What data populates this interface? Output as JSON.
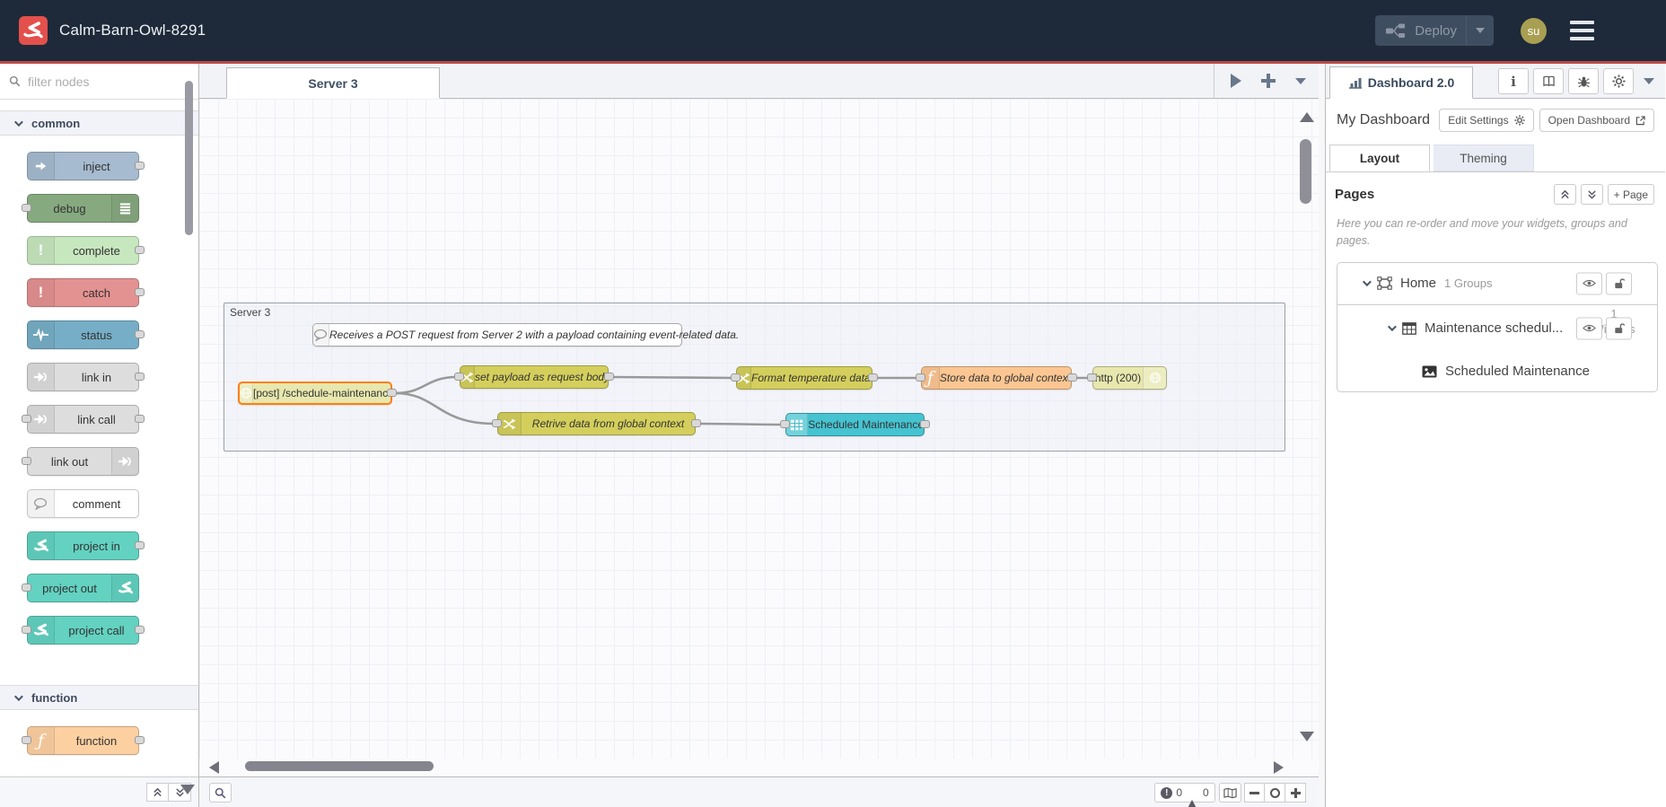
{
  "colors": {
    "header_bg": "#1e2a3a",
    "brand_red": "#e4504c",
    "header_underline": "#b94a48",
    "selected_node_border": "#ff7f0e",
    "wire": "#999999",
    "avatar_bg": "#a89f52"
  },
  "icons_used": [
    "node-red-logo",
    "deploy-nodes-icon",
    "caret-down-icon",
    "hamburger-icon",
    "search-icon",
    "chevron-icon",
    "inject-arrow-icon",
    "debug-lines-icon",
    "exclamation-icon",
    "status-pulse-icon",
    "link-icon",
    "comment-bubble-icon",
    "project-icon",
    "function-f-icon",
    "http-globe-icon",
    "change-shuffle-icon",
    "table-icon",
    "chart-bars-icon",
    "info-icon",
    "book-icon",
    "bug-icon",
    "gear-icon",
    "external-link-icon",
    "page-frame-icon",
    "grid-icon",
    "image-icon",
    "eye-icon",
    "unlock-icon",
    "map-icon",
    "minus-icon",
    "circle-icon",
    "plus-icon",
    "warning-triangle-icon",
    "error-circle-icon"
  ],
  "header": {
    "title": "Calm-Barn-Owl-8291",
    "deploy_label": "Deploy",
    "avatar_text": "su"
  },
  "palette": {
    "filter_placeholder": "filter nodes",
    "categories": [
      {
        "label": "common",
        "nodes": [
          {
            "label": "inject",
            "color": "#a6bbcf",
            "icon": "arrow",
            "icon_side": "left",
            "ports": "out"
          },
          {
            "label": "debug",
            "color": "#87a980",
            "icon": "lines",
            "icon_side": "right",
            "ports": "in"
          },
          {
            "label": "complete",
            "color": "#c7e7bf",
            "icon": "exclaim",
            "icon_side": "left",
            "ports": "out"
          },
          {
            "label": "catch",
            "color": "#e49191",
            "icon": "exclaim",
            "icon_side": "left",
            "ports": "out"
          },
          {
            "label": "status",
            "color": "#76aec7",
            "icon": "pulse",
            "icon_side": "left",
            "ports": "out"
          },
          {
            "label": "link in",
            "color": "#dddddd",
            "icon": "link",
            "icon_side": "left",
            "ports": "out"
          },
          {
            "label": "link call",
            "color": "#dddddd",
            "icon": "link",
            "icon_side": "left",
            "ports": "both"
          },
          {
            "label": "link out",
            "color": "#dddddd",
            "icon": "link",
            "icon_side": "right",
            "ports": "in"
          },
          {
            "label": "comment",
            "color": "#ffffff",
            "icon": "comment",
            "icon_side": "left",
            "ports": "none"
          },
          {
            "label": "project in",
            "color": "#63d2c1",
            "icon": "project",
            "icon_side": "left",
            "ports": "out"
          },
          {
            "label": "project out",
            "color": "#63d2c1",
            "icon": "project",
            "icon_side": "right",
            "ports": "in"
          },
          {
            "label": "project call",
            "color": "#63d2c1",
            "icon": "project",
            "icon_side": "left",
            "ports": "both"
          }
        ]
      },
      {
        "label": "function",
        "nodes": [
          {
            "label": "function",
            "color": "#fdd0a2",
            "icon": "fn",
            "icon_side": "left",
            "ports": "both"
          }
        ]
      }
    ]
  },
  "workspace": {
    "tab_label": "Server 3",
    "group_label": "Server 3",
    "nodes": [
      {
        "id": "comment1",
        "label": "Receives a POST request from Server 2 with a payload containing event-related data.",
        "color": "#ffffff",
        "icon": "comment",
        "icon_side": "left",
        "ports": "none",
        "italic": true,
        "comment": true
      },
      {
        "id": "post",
        "label": "[post] /schedule-maintenance",
        "color": "#e7e7ae",
        "icon": "globe",
        "icon_side": "left",
        "ports": "out",
        "selected": true
      },
      {
        "id": "set-payload",
        "label": "set payload as request body",
        "color": "#d4cf5c",
        "icon": "shuffle",
        "icon_side": "left",
        "ports": "both",
        "italic": true
      },
      {
        "id": "format-temp",
        "label": "Format temperature data.",
        "color": "#d4cf5c",
        "icon": "shuffle",
        "icon_side": "left",
        "ports": "both",
        "italic": true
      },
      {
        "id": "store-global",
        "label": "Store data to global context",
        "color": "#fcc692",
        "icon": "fn",
        "icon_side": "left",
        "ports": "both",
        "italic": true
      },
      {
        "id": "http200",
        "label": "http (200)",
        "color": "#e7e7ae",
        "icon": "globe",
        "icon_side": "right",
        "ports": "in"
      },
      {
        "id": "retrieve-global",
        "label": "Retrive data from global context",
        "color": "#d4cf5c",
        "icon": "shuffle",
        "icon_side": "left",
        "ports": "both",
        "italic": true
      },
      {
        "id": "sched-table",
        "label": "Scheduled Maintenance",
        "color": "#45c3d1",
        "icon": "table",
        "icon_side": "left",
        "ports": "both"
      }
    ]
  },
  "sidebar": {
    "tab_label": "Dashboard 2.0",
    "dashboard_title": "My Dashboard",
    "edit_settings_label": "Edit Settings",
    "open_dashboard_label": "Open Dashboard",
    "tabs": {
      "layout": "Layout",
      "theming": "Theming"
    },
    "pages": {
      "title": "Pages",
      "add_page_label": "+ Page",
      "help_text": "Here you can re-order and move your widgets, groups and pages."
    },
    "tree": {
      "page": {
        "label": "Home",
        "badge": "1 Groups"
      },
      "group": {
        "label": "Maintenance schedul...",
        "badge_count": "1",
        "badge_word": "Widgets"
      },
      "widget": {
        "label": "Scheduled Maintenance"
      }
    }
  },
  "statusbar": {
    "errors": "0",
    "warnings": "0"
  }
}
